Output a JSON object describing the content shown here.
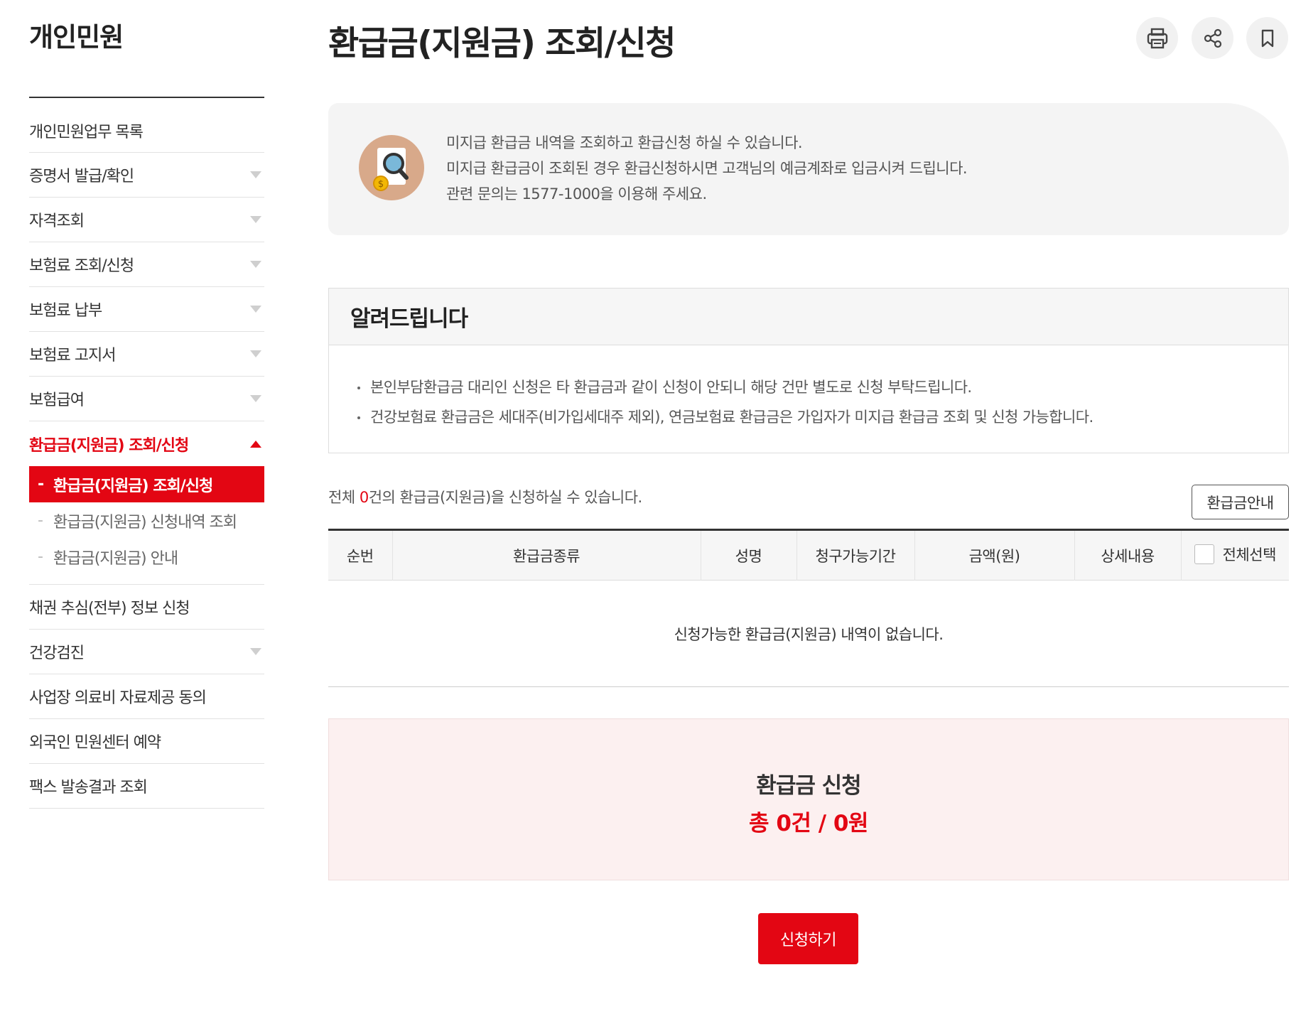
{
  "sidebar": {
    "title": "개인민원",
    "items": [
      {
        "label": "개인민원업무 목록"
      },
      {
        "label": "증명서 발급/확인"
      },
      {
        "label": "자격조회"
      },
      {
        "label": "보험료 조회/신청"
      },
      {
        "label": "보험료 납부"
      },
      {
        "label": "보험료 고지서"
      },
      {
        "label": "보험급여"
      },
      {
        "label": "환급금(지원금) 조회/신청"
      },
      {
        "label": "채권 추심(전부) 정보 신청"
      },
      {
        "label": "건강검진"
      },
      {
        "label": "사업장 의료비 자료제공 동의"
      },
      {
        "label": "외국인 민원센터 예약"
      },
      {
        "label": "팩스 발송결과 조회"
      }
    ],
    "subitems": [
      {
        "label": "환급금(지원금) 조회/신청"
      },
      {
        "label": "환급금(지원금) 신청내역 조회"
      },
      {
        "label": "환급금(지원금) 안내"
      }
    ],
    "sub_dash": "-"
  },
  "header": {
    "title": "환급금(지원금) 조회/신청",
    "tools": [
      "print-icon",
      "share-icon",
      "bookmark-icon"
    ]
  },
  "intro": {
    "icon": "refund-search-icon",
    "lines": [
      "미지급 환급금 내역을 조회하고 환급신청 하실 수 있습니다.",
      "미지급 환급금이 조회된 경우 환급신청하시면 고객님의 예금계좌로 입금시켜 드립니다.",
      "관련 문의는 1577-1000을 이용해 주세요."
    ]
  },
  "notice": {
    "title": "알려드립니다",
    "items": [
      "본인부담환급금 대리인 신청은 타 환급금과 같이 신청이 안되니 해당 건만 별도로 신청 부탁드립니다.",
      "건강보험료 환급금은 세대주(비가입세대주 제외), 연금보험료 환급금은 가입자가 미지급 환급금 조회 및 신청 가능합니다."
    ]
  },
  "summary": {
    "prefix": "전체 ",
    "count": "0",
    "suffix": "건의 환급금(지원금)을 신청하실 수 있습니다.",
    "guide_button": "환급금안내"
  },
  "table": {
    "headers": [
      "순번",
      "환급금종류",
      "성명",
      "청구가능기간",
      "금액(원)",
      "상세내용",
      "전체선택"
    ],
    "empty_message": "신청가능한 환급금(지원금) 내역이 없습니다."
  },
  "total": {
    "label": "환급금 신청",
    "value": "총 0건 / 0원"
  },
  "apply_button": "신청하기",
  "colors": {
    "accent": "#e30613",
    "total_bg": "#fcf0f0",
    "intro_bg": "#f4f4f4"
  }
}
